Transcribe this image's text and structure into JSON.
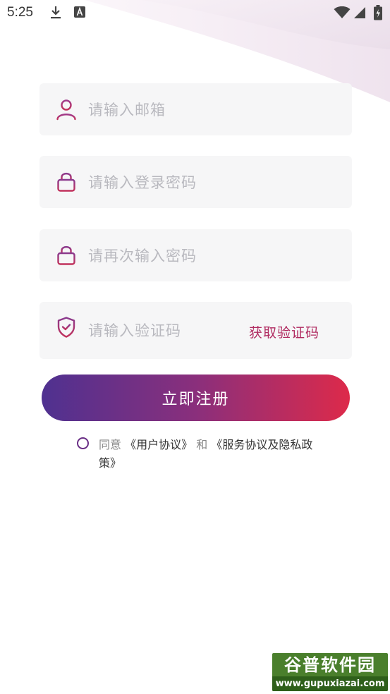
{
  "status_bar": {
    "time": "5:25",
    "icons": [
      "download-icon",
      "notification-a-icon",
      "wifi-icon",
      "signal-icon",
      "battery-charging-icon"
    ]
  },
  "form": {
    "email": {
      "placeholder": "请输入邮箱",
      "icon": "user-icon"
    },
    "password": {
      "placeholder": "请输入登录密码",
      "icon": "lock-icon"
    },
    "confirm_password": {
      "placeholder": "请再次输入密码",
      "icon": "lock-icon"
    },
    "verification": {
      "placeholder": "请输入验证码",
      "icon": "shield-check-icon",
      "get_code_label": "获取验证码"
    }
  },
  "register_button": {
    "label": "立即注册"
  },
  "agreement": {
    "prefix": "同意",
    "user_agreement": "《用户协议》",
    "and": "和",
    "privacy_policy": "《服务协议及隐私政策》"
  },
  "watermark": {
    "top": "谷普软件园",
    "bottom": "www.gupuxiazai.com"
  },
  "colors": {
    "accent": "#b02a60",
    "gradient_start": "#4f3190",
    "gradient_end": "#dd2a4a",
    "field_bg": "#f6f6f7"
  }
}
